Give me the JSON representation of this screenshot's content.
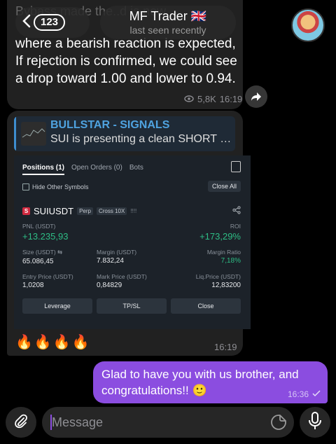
{
  "header": {
    "unread_count": "123",
    "contact_name": "MF Trader 🇬🇧",
    "contact_status": "last seen recently"
  },
  "messages": [
    {
      "faded_text": "Bybass made the..d is now..",
      "text": "where a bearish reaction is expected, If rejection is confirmed, we could see a drop toward 1.00 and lower to 0.94.",
      "views": "5,8K",
      "time": "16:19"
    },
    {
      "reply_title": "BULLSTAR - SIGNALS",
      "reply_snippet": "SUI is presenting a clean SHORT o...",
      "emojis": "🔥🔥🔥🔥",
      "time": "16:19"
    }
  ],
  "trade": {
    "tabs": [
      "Positions (1)",
      "Open Orders (0)",
      "Bots"
    ],
    "hide_other_symbols": "Hide Other Symbols",
    "close_all": "Close All",
    "symbol_icon": "S",
    "symbol": "SUIUSDT",
    "tag_perp": "Perp",
    "tag_cross": "Cross 10X",
    "bars": "!!!!",
    "pnl_label": "PNL (USDT)",
    "pnl_value": "+13.235,93",
    "roi_label": "ROI",
    "roi_value": "+173,29%",
    "size_label": "Size (USDT) ⇆",
    "size_value": "65.086,45",
    "margin_label": "Margin (USDT)",
    "margin_value": "7.832,24",
    "margin_ratio_label": "Margin Ratio",
    "margin_ratio_value": "7,18%",
    "entry_label": "Entry Price (USDT)",
    "entry_value": "1,0208",
    "mark_label": "Mark Price (USDT)",
    "mark_value": "0,84829",
    "liq_label": "Liq.Price (USDT)",
    "liq_value": "12,83200",
    "actions": [
      "Leverage",
      "TP/SL",
      "Close"
    ]
  },
  "outgoing": {
    "text": "Glad to have you with us brother, and congratulations!! 🙂",
    "time": "16:36"
  },
  "composer": {
    "placeholder": "Message"
  },
  "colors": {
    "outgoing_bubble": "#8b4de0",
    "pnl_green": "#2ebd85",
    "reply_accent": "#4fa3e0"
  },
  "icons": [
    "back-chevron-icon",
    "eye-icon",
    "share-forward-icon",
    "paperclip-icon",
    "sticker-icon",
    "microphone-icon",
    "double-check-icon",
    "flag-icon"
  ]
}
